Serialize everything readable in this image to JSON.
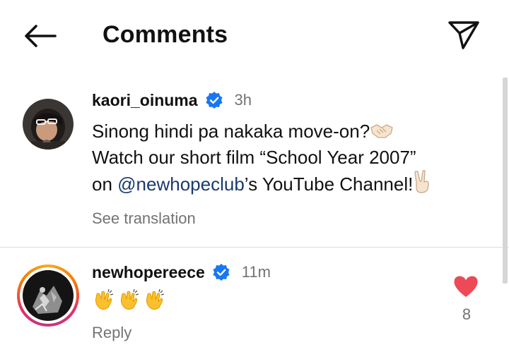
{
  "header": {
    "back_icon": "arrow-left-icon",
    "title": "Comments",
    "share_icon": "paper-plane-icon"
  },
  "caption": {
    "username": "kaori_oinuma",
    "verified": true,
    "time": "3h",
    "line1": "Sinong hindi pa nakaka move-on?",
    "line1_emoji": "handshake-emoji",
    "line2": "Watch our short film “School Year 2007”",
    "line3_prefix": "on ",
    "mention": "@newhopeclub",
    "line3_suffix": "’s YouTube Channel!",
    "line3_emoji": "victory-hand-emoji",
    "see_translation": "See translation"
  },
  "comment": {
    "username": "newhopereece",
    "verified": true,
    "time": "11m",
    "emojis": [
      "clapping-hands-emoji",
      "clapping-hands-emoji",
      "clapping-hands-emoji"
    ],
    "reply": "Reply",
    "like_icon": "heart-filled-icon",
    "like_count": "8"
  },
  "colors": {
    "accent_verified": "#1877f2",
    "mention": "#1a3a6e",
    "secondary_text": "#737373",
    "like": "#ed4956"
  }
}
